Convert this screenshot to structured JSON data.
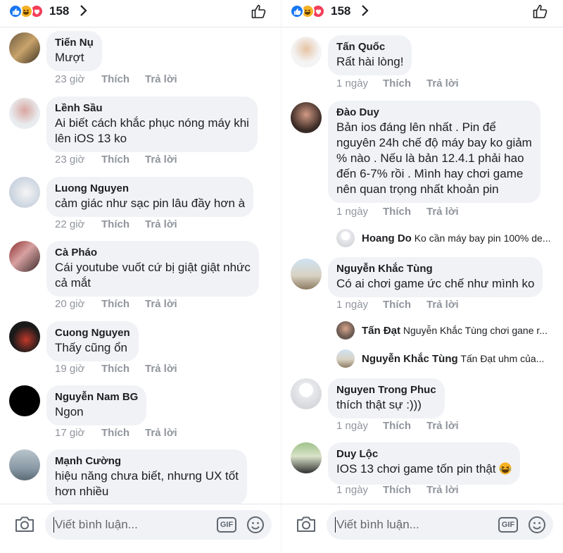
{
  "colors": {
    "like_blue": "#1877f2",
    "haha_yellow": "#f7b125",
    "love_red": "#f33e58",
    "bubble_bg": "#f0f2f5",
    "meta_gray": "#90949c"
  },
  "left_pane": {
    "reaction_count": "158",
    "reaction_icons": [
      "like-icon",
      "haha-icon",
      "love-icon"
    ],
    "comments": [
      {
        "name": "Tiến Nụ",
        "text": "Mượt",
        "time": "23 giờ",
        "like": "Thích",
        "reply": "Trả lời"
      },
      {
        "name": "Lềnh Sầu",
        "text": "Ai biết cách khắc phục nóng máy khi\nlên iOS 13 ko",
        "time": "23 giờ",
        "like": "Thích",
        "reply": "Trả lời"
      },
      {
        "name": "Luong Nguyen",
        "text": "cảm giác như sạc pin lâu đầy hơn à",
        "time": "22 giờ",
        "like": "Thích",
        "reply": "Trả lời"
      },
      {
        "name": "Cà Pháo",
        "text": "Cái youtube vuốt cứ bị giật giật nhức\ncả mắt",
        "time": "20 giờ",
        "like": "Thích",
        "reply": "Trả lời"
      },
      {
        "name": "Cuong Nguyen",
        "text": "Thấy cũng ổn",
        "time": "19 giờ",
        "like": "Thích",
        "reply": "Trả lời"
      },
      {
        "name": "Nguyễn Nam BG",
        "text": "Ngon",
        "time": "17 giờ",
        "like": "Thích",
        "reply": "Trả lời"
      },
      {
        "name": "Mạnh Cường",
        "text": "hiệu năng chưa biết, nhưng UX tốt\nhơn nhiều"
      }
    ],
    "composer": {
      "placeholder": "Viết bình luận...",
      "gif_label": "GIF"
    }
  },
  "right_pane": {
    "reaction_count": "158",
    "reaction_icons": [
      "like-icon",
      "haha-icon",
      "love-icon"
    ],
    "comments": [
      {
        "name": "Tấn Quốc",
        "text": "Rất hài lòng!",
        "time": "1 ngày",
        "like": "Thích",
        "reply": "Trả lời"
      },
      {
        "name": "Đào Duy",
        "text": "Bản ios đáng lên nhất . Pin để\nnguyên 24h chế độ máy bay ko giảm\n% nào . Nếu là bản 12.4.1 phải hao\nđến 6-7% rồi . Mình hay chơi game\nnên quan trọng nhất khoản pin",
        "time": "1 ngày",
        "like": "Thích",
        "reply": "Trả lời"
      },
      {
        "name": "Nguyễn Khắc Tùng",
        "text": "Có ai chơi game ức chế như mình ko",
        "time": "1 ngày",
        "like": "Thích",
        "reply": "Trả lời"
      },
      {
        "name": "Nguyen Trong Phuc",
        "text": "thích thật sự :)))",
        "time": "1 ngày",
        "like": "Thích",
        "reply": "Trả lời"
      },
      {
        "name": "Duy Lộc",
        "text": "IOS 13 chơi game tốn pin thật",
        "time": "1 ngày",
        "like": "Thích",
        "reply": "Trả lời"
      }
    ],
    "replies": [
      {
        "name": "Hoang Do",
        "text": "Ko cần máy bay pin 100% de..."
      },
      {
        "name": "Tấn Đạt",
        "text": "Nguyễn Khắc Tùng chơi gane r..."
      },
      {
        "name": "Nguyễn Khắc Tùng",
        "text": "Tấn Đạt uhm của..."
      }
    ],
    "composer": {
      "placeholder": "Viết bình luận...",
      "gif_label": "GIF"
    }
  }
}
